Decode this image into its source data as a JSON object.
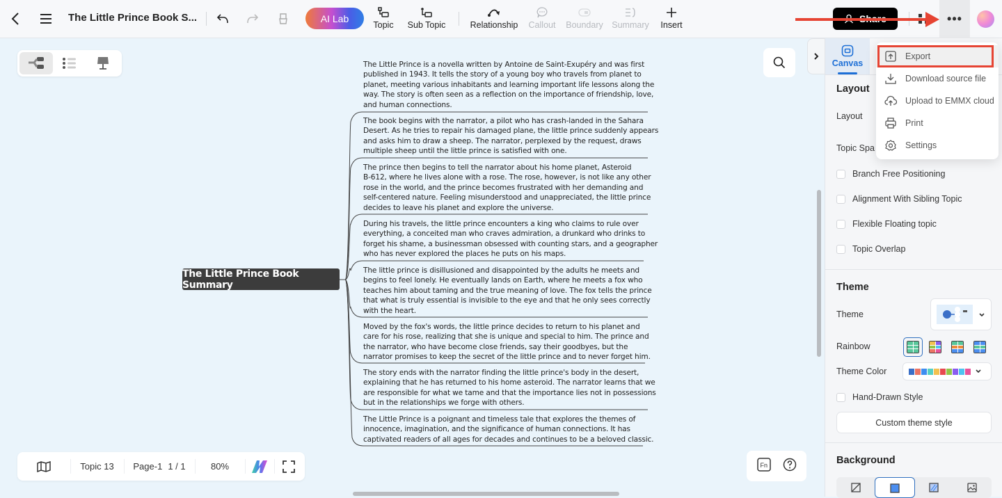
{
  "topbar": {
    "doc_title": "The Little Prince Book S...",
    "ai_lab": "AI Lab",
    "tools": [
      {
        "label": "Topic",
        "icon": "topic-icon",
        "enabled": true
      },
      {
        "label": "Sub Topic",
        "icon": "subtopic-icon",
        "enabled": true
      },
      {
        "label": "Relationship",
        "icon": "relationship-icon",
        "enabled": true
      },
      {
        "label": "Callout",
        "icon": "callout-icon",
        "enabled": false
      },
      {
        "label": "Boundary",
        "icon": "boundary-icon",
        "enabled": false
      },
      {
        "label": "Summary",
        "icon": "summary-icon",
        "enabled": false
      },
      {
        "label": "Insert",
        "icon": "plus-icon",
        "enabled": true
      }
    ],
    "share": "Share",
    "more": "•••"
  },
  "canvas": {
    "central_topic": "The Little Prince Book Summary",
    "topics": [
      "The Little Prince is a novella written by Antoine de Saint-Exupéry and was first\npublished in 1943. It tells the story of a young boy who travels from planet to\nplanet, meeting various inhabitants and learning important life lessons along the\nway. The story is often seen as a reflection on the importance of friendship, love,\nand human connections.",
      "The book begins with the narrator, a pilot who has crash-landed in the Sahara\nDesert. As he tries to repair his damaged plane, the little prince suddenly appears\nand asks him to draw a sheep. The narrator, perplexed by the request, draws\nmultiple sheep until the little prince is satisfied with one.",
      "The prince then begins to tell the narrator about his home planet, Asteroid\nB-612, where he lives alone with a rose. The rose, however, is not like any other\nrose in the world, and the prince becomes frustrated with her demanding and\nself-centered nature. Feeling misunderstood and unappreciated, the little prince\ndecides to leave his planet and explore the universe.",
      "During his travels, the little prince encounters a king who claims to rule over\neverything, a conceited man who craves admiration, a drunkard who drinks to\nforget his shame, a businessman obsessed with counting stars, and a geographer\nwho has never explored the places he puts on his maps.",
      "The little prince is disillusioned and disappointed by the adults he meets and\nbegins to feel lonely. He eventually lands on Earth, where he meets a fox who\nteaches him about taming and the true meaning of love. The fox tells the prince\nthat what is truly essential is invisible to the eye and that he only sees correctly\nwith the heart.",
      "Moved by the fox's words, the little prince decides to return to his planet and\ncare for his rose, realizing that she is unique and special to him. The prince and\nthe narrator, who have become close friends, say their goodbyes, but the\nnarrator promises to keep the secret of the little prince and to never forget him.",
      "The story ends with the narrator finding the little prince's body in the desert,\nexplaining that he has returned to his home asteroid. The narrator learns that we\nare responsible for what we tame and that the importance lies not in possessions\nbut in the relationships we forge with others.",
      "The Little Prince is a poignant and timeless tale that explores the themes of\ninnocence, imagination, and the significance of human connections. It has\ncaptivated readers of all ages for decades and continues to be a beloved classic."
    ]
  },
  "bottombar": {
    "topic_count": "Topic 13",
    "page": "Page-1",
    "page_of": "1 / 1",
    "zoom": "80%"
  },
  "panel": {
    "tab": "Canvas",
    "layout_section": "Layout",
    "layout_label": "Layout",
    "topic_spacing_label": "Topic Spa",
    "checkboxes": [
      {
        "label": "Branch Free Positioning",
        "checked": false
      },
      {
        "label": "Alignment With Sibling Topic",
        "checked": false
      },
      {
        "label": "Flexible Floating topic",
        "checked": false
      },
      {
        "label": "Topic Overlap",
        "checked": false
      }
    ],
    "theme_section": "Theme",
    "theme_label": "Theme",
    "rainbow_label": "Rainbow",
    "theme_color_label": "Theme Color",
    "theme_colors": [
      "#3a6fc7",
      "#ec7464",
      "#3f8ef0",
      "#56d0c4",
      "#f2c150",
      "#e8494f",
      "#94c447",
      "#8b5cf0",
      "#4fc3f0",
      "#e8539a"
    ],
    "hand_drawn": {
      "label": "Hand-Drawn Style",
      "checked": false
    },
    "custom_theme": "Custom theme style",
    "background_section": "Background"
  },
  "menu": {
    "items": [
      {
        "label": "Export",
        "icon": "export-icon",
        "highlighted": true
      },
      {
        "label": "Download source file",
        "icon": "download-icon",
        "highlighted": false
      },
      {
        "label": "Upload to EMMX cloud",
        "icon": "cloud-upload-icon",
        "highlighted": false
      },
      {
        "label": "Print",
        "icon": "printer-icon",
        "highlighted": false
      },
      {
        "label": "Settings",
        "icon": "settings-icon",
        "highlighted": false
      }
    ]
  },
  "colors": {
    "accent": "#1d6fd6",
    "annotation_red": "#e64433",
    "canvas_bg": "#eaf4fb",
    "central_topic_bg": "#3c3c3c"
  }
}
